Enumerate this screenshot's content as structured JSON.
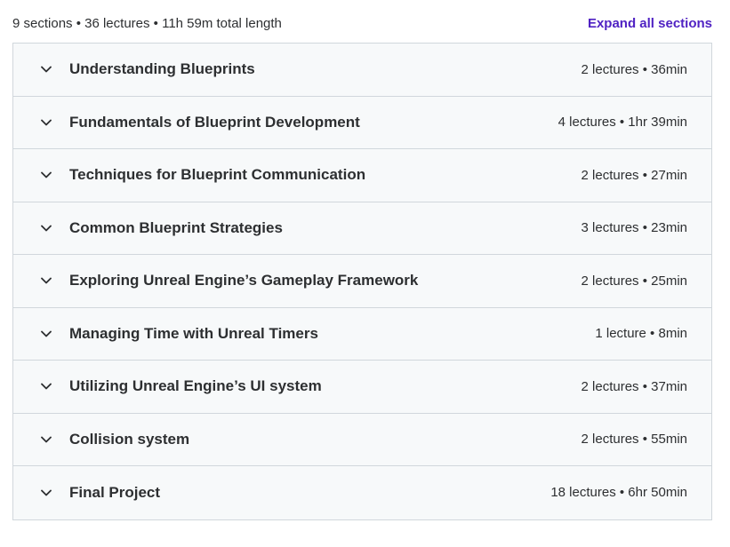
{
  "summary": {
    "text": "9 sections • 36 lectures • 11h 59m total length",
    "expand_label": "Expand all sections"
  },
  "sections": [
    {
      "title": "Understanding Blueprints",
      "meta": "2 lectures • 36min"
    },
    {
      "title": "Fundamentals of Blueprint Development",
      "meta": "4 lectures • 1hr 39min"
    },
    {
      "title": "Techniques for Blueprint Communication",
      "meta": "2 lectures • 27min"
    },
    {
      "title": "Common Blueprint Strategies",
      "meta": "3 lectures • 23min"
    },
    {
      "title": "Exploring Unreal Engine’s Gameplay Framework",
      "meta": "2 lectures • 25min"
    },
    {
      "title": "Managing Time with Unreal Timers",
      "meta": "1 lecture • 8min"
    },
    {
      "title": "Utilizing Unreal Engine’s UI system",
      "meta": "2 lectures • 37min"
    },
    {
      "title": "Collision system",
      "meta": "2 lectures • 55min"
    },
    {
      "title": "Final Project",
      "meta": "18 lectures • 6hr 50min"
    }
  ],
  "icons": {
    "chevron": "chevron-down-icon"
  },
  "colors": {
    "accent": "#5022c3",
    "text": "#2d2f31",
    "panel": "#f7f9fa",
    "border": "#d1d7dc"
  }
}
